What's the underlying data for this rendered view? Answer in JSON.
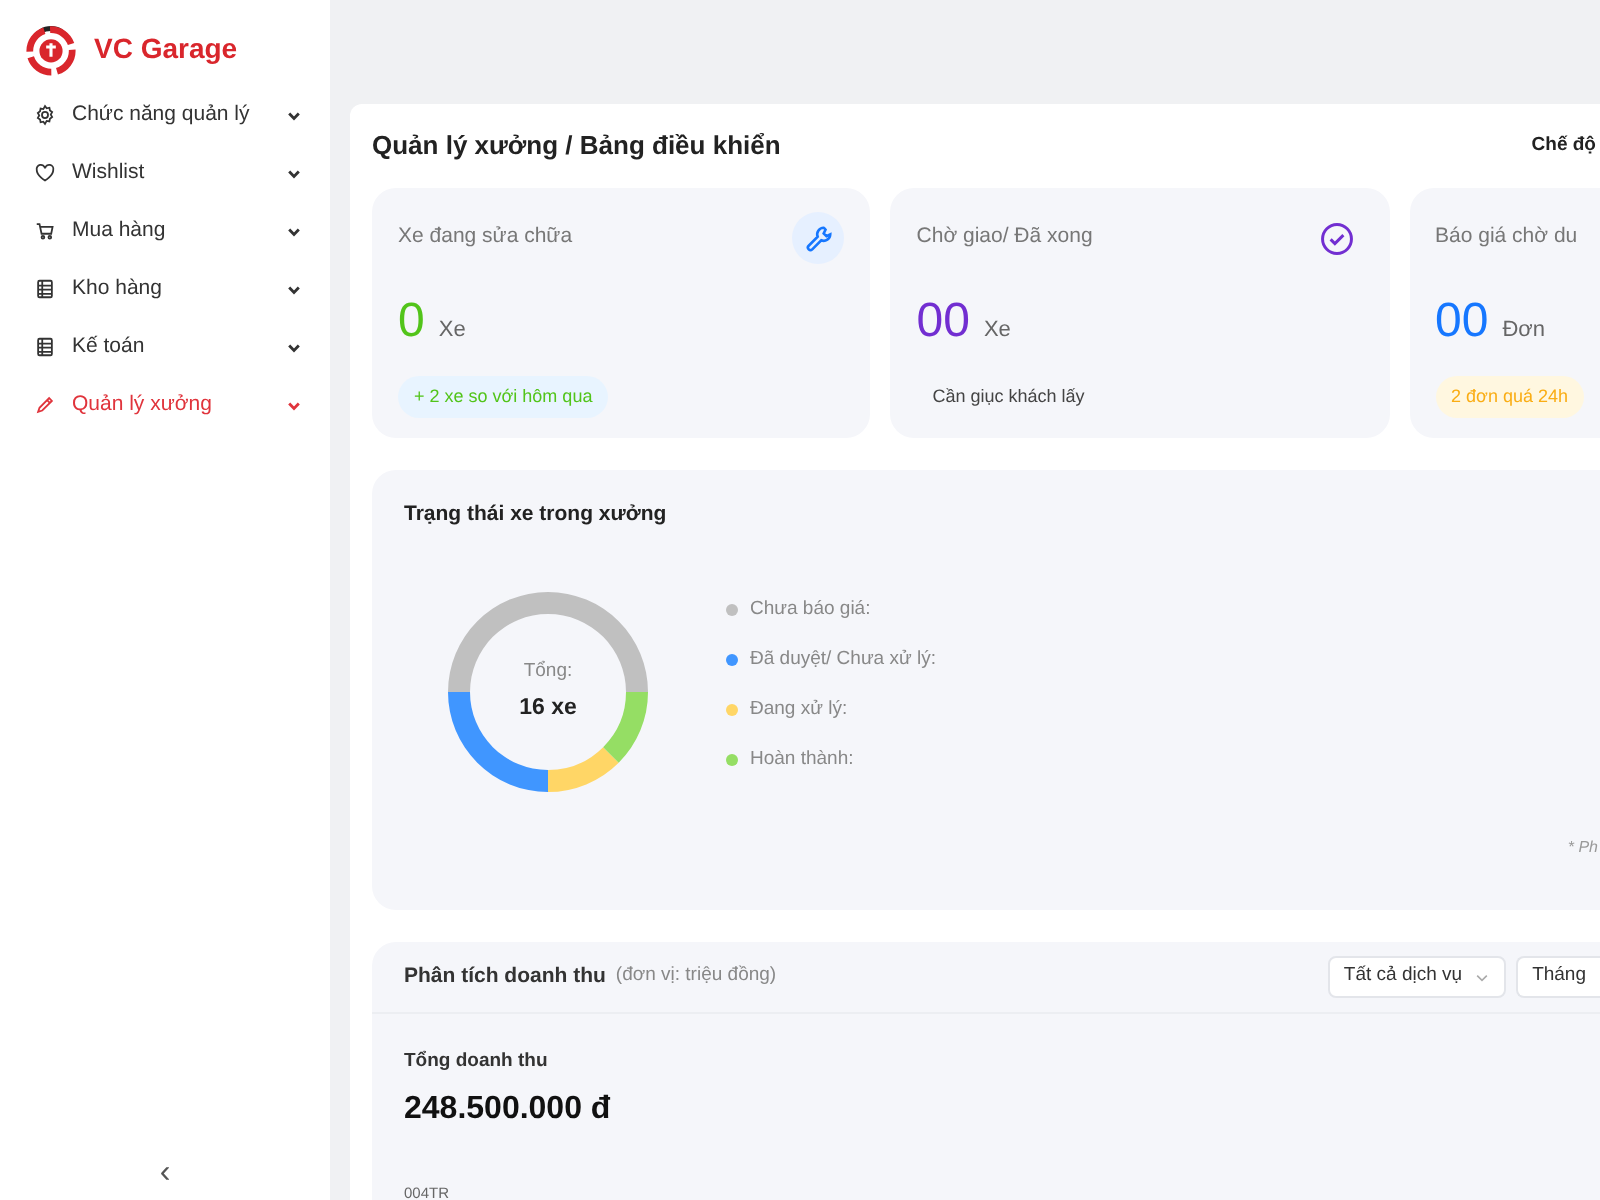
{
  "brand": {
    "name": "VC Garage"
  },
  "sidebar": {
    "items": [
      {
        "label": "Chức năng quản lý",
        "selected": false
      },
      {
        "label": "Wishlist",
        "selected": false
      },
      {
        "label": "Mua hàng",
        "selected": false
      },
      {
        "label": "Kho hàng",
        "selected": false
      },
      {
        "label": "Kế toán",
        "selected": false
      },
      {
        "label": "Quản lý xưởng",
        "selected": true
      }
    ],
    "collapse": "‹"
  },
  "header": {
    "breadcrumb": "Quản lý xưởng / Bảng điều khiển",
    "mode": "Chế độ"
  },
  "stats": [
    {
      "title": "Xe đang sửa chữa",
      "value": "0",
      "unit": "Xe",
      "note": "+ 2 xe so với hôm qua",
      "color": "#52c41a"
    },
    {
      "title": "Chờ giao/ Đã xong",
      "value": "00",
      "unit": "Xe",
      "note": "Cần giục khách lấy",
      "color": "#722ed1"
    },
    {
      "title": "Báo giá chờ du",
      "value": "00",
      "unit": "Đơn",
      "note": "2 đơn quá 24h",
      "color": "#1677ff"
    }
  ],
  "status": {
    "title": "Trạng thái xe trong xưởng",
    "total_label": "Tổng:",
    "total": "16 xe",
    "legend": [
      {
        "label": "Chưa báo giá:",
        "color": "#c0c0c0"
      },
      {
        "label": "Đã duyệt/ Chưa xử lý:",
        "color": "#4096ff"
      },
      {
        "label": "Đang xử lý:",
        "color": "#ffd666"
      },
      {
        "label": "Hoàn thành:",
        "color": "#95de64"
      }
    ],
    "footnote": "* Ph"
  },
  "revenue": {
    "title": "Phân tích doanh thu",
    "unit": "(đơn vị: triệu đồng)",
    "filters": [
      "Tất cả dịch vụ",
      "Tháng"
    ],
    "total_label": "Tổng doanh thu",
    "total": "248.500.000 đ",
    "axis_label": "004TR"
  }
}
